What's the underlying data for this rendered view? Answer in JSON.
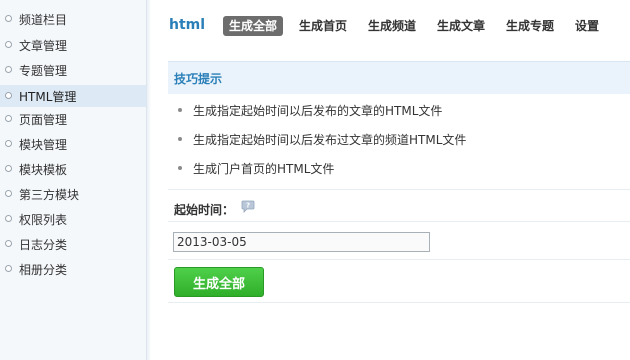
{
  "sidebar": {
    "items": [
      {
        "label": "频道栏目"
      },
      {
        "label": "文章管理"
      },
      {
        "label": "专题管理"
      },
      {
        "label": "HTML管理"
      },
      {
        "label": "页面管理"
      },
      {
        "label": "模块管理"
      },
      {
        "label": "模块模板"
      },
      {
        "label": "第三方模块"
      },
      {
        "label": "权限列表"
      },
      {
        "label": "日志分类"
      },
      {
        "label": "相册分类"
      }
    ],
    "active_index": 3
  },
  "header": {
    "title": "html",
    "tabs": [
      {
        "label": "生成全部"
      },
      {
        "label": "生成首页"
      },
      {
        "label": "生成频道"
      },
      {
        "label": "生成文章"
      },
      {
        "label": "生成专题"
      },
      {
        "label": "设置"
      }
    ],
    "active_tab_index": 0
  },
  "tips": {
    "title": "技巧提示",
    "items": [
      "生成指定起始时间以后发布的文章的HTML文件",
      "生成指定起始时间以后发布过文章的频道HTML文件",
      "生成门户首页的HTML文件"
    ]
  },
  "form": {
    "start_label": "起始时间：",
    "start_value": "2013-03-05",
    "submit_label": "生成全部"
  },
  "colors": {
    "accent": "#2a7fb8",
    "active_tab_bg": "#6d6d6d",
    "button_green": "#35b52f",
    "tips_bg": "#eaf3fb",
    "sidebar_bg": "#f4f8fb"
  },
  "icons": {
    "help": "help-bubble-icon"
  }
}
